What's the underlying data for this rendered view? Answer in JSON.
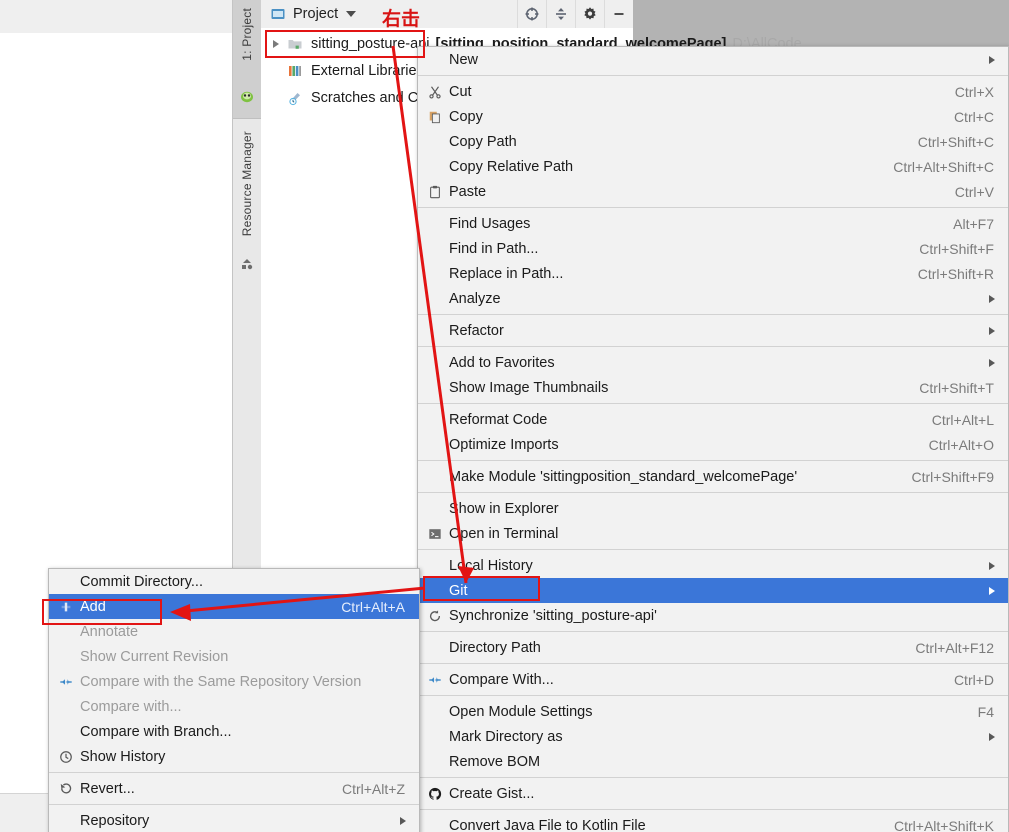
{
  "ide": {
    "toolwindow_tabs": [
      {
        "label": "1: Project",
        "icon": "project-icon",
        "active": true
      },
      {
        "label": "Resource Manager",
        "icon": "resource-manager-icon",
        "active": false
      }
    ],
    "tree_header": {
      "title": "Project",
      "icon": "project-folder-icon",
      "caret": "chevron-down-icon"
    },
    "tree_toolbar": [
      {
        "icon": "locate-icon"
      },
      {
        "icon": "collapse-all-icon"
      },
      {
        "icon": "gear-icon"
      },
      {
        "icon": "minimize-icon"
      }
    ],
    "tree_rows": [
      {
        "label": "sitting_posture-api",
        "detail": "[sitting_position_standard_welcomePage]",
        "path": "D:\\AllCode",
        "icon": "module-folder-icon",
        "expandable": true
      },
      {
        "label": "External Libraries",
        "icon": "external-libraries-icon",
        "expandable": false
      },
      {
        "label": "Scratches and Consoles",
        "icon": "scratches-icon",
        "expandable": false
      }
    ]
  },
  "annotations": {
    "right_click_label": "右击"
  },
  "context_menu": {
    "items": [
      {
        "label": "New",
        "icon": "",
        "accel": "",
        "submenu": true
      },
      {
        "sep": true
      },
      {
        "label": "Cut",
        "icon": "cut-icon",
        "accel": "Ctrl+X",
        "submenu": false
      },
      {
        "label": "Copy",
        "icon": "copy-icon",
        "accel": "Ctrl+C",
        "submenu": false
      },
      {
        "label": "Copy Path",
        "icon": "",
        "accel": "Ctrl+Shift+C",
        "submenu": false
      },
      {
        "label": "Copy Relative Path",
        "icon": "",
        "accel": "Ctrl+Alt+Shift+C",
        "submenu": false
      },
      {
        "label": "Paste",
        "icon": "paste-icon",
        "accel": "Ctrl+V",
        "submenu": false
      },
      {
        "sep": true
      },
      {
        "label": "Find Usages",
        "icon": "",
        "accel": "Alt+F7",
        "submenu": false
      },
      {
        "label": "Find in Path...",
        "icon": "",
        "accel": "Ctrl+Shift+F",
        "submenu": false
      },
      {
        "label": "Replace in Path...",
        "icon": "",
        "accel": "Ctrl+Shift+R",
        "submenu": false
      },
      {
        "label": "Analyze",
        "icon": "",
        "accel": "",
        "submenu": true
      },
      {
        "sep": true
      },
      {
        "label": "Refactor",
        "icon": "",
        "accel": "",
        "submenu": true
      },
      {
        "sep": true
      },
      {
        "label": "Add to Favorites",
        "icon": "",
        "accel": "",
        "submenu": true
      },
      {
        "label": "Show Image Thumbnails",
        "icon": "",
        "accel": "Ctrl+Shift+T",
        "submenu": false
      },
      {
        "sep": true
      },
      {
        "label": "Reformat Code",
        "icon": "",
        "accel": "Ctrl+Alt+L",
        "submenu": false
      },
      {
        "label": "Optimize Imports",
        "icon": "",
        "accel": "Ctrl+Alt+O",
        "submenu": false
      },
      {
        "sep": true
      },
      {
        "label": "Make Module 'sittingposition_standard_welcomePage'",
        "icon": "",
        "accel": "Ctrl+Shift+F9",
        "submenu": false
      },
      {
        "sep": true
      },
      {
        "label": "Show in Explorer",
        "icon": "",
        "accel": "",
        "submenu": false
      },
      {
        "label": "Open in Terminal",
        "icon": "terminal-icon",
        "accel": "",
        "submenu": false
      },
      {
        "sep": true
      },
      {
        "label": "Local History",
        "icon": "",
        "accel": "",
        "submenu": true
      },
      {
        "label": "Git",
        "icon": "",
        "accel": "",
        "submenu": true,
        "selected": true
      },
      {
        "label": "Synchronize 'sitting_posture-api'",
        "icon": "sync-icon",
        "accel": "",
        "submenu": false
      },
      {
        "sep": true
      },
      {
        "label": "Directory Path",
        "icon": "",
        "accel": "Ctrl+Alt+F12",
        "submenu": false
      },
      {
        "sep": true
      },
      {
        "label": "Compare With...",
        "icon": "compare-icon",
        "accel": "Ctrl+D",
        "submenu": false
      },
      {
        "sep": true
      },
      {
        "label": "Open Module Settings",
        "icon": "",
        "accel": "F4",
        "submenu": false
      },
      {
        "label": "Mark Directory as",
        "icon": "",
        "accel": "",
        "submenu": true
      },
      {
        "label": "Remove BOM",
        "icon": "",
        "accel": "",
        "submenu": false
      },
      {
        "sep": true
      },
      {
        "label": "Create Gist...",
        "icon": "github-icon",
        "accel": "",
        "submenu": false
      },
      {
        "sep": true
      },
      {
        "label": "Convert Java File to Kotlin File",
        "icon": "",
        "accel": "Ctrl+Alt+Shift+K",
        "submenu": false
      }
    ]
  },
  "git_submenu": {
    "items": [
      {
        "label": "Commit Directory...",
        "icon": "",
        "accel": "",
        "submenu": false,
        "disabled": false
      },
      {
        "label": "Add",
        "icon": "add-vcs-icon",
        "accel": "Ctrl+Alt+A",
        "submenu": false,
        "selected": true
      },
      {
        "label": "Annotate",
        "icon": "",
        "accel": "",
        "submenu": false,
        "disabled": true
      },
      {
        "label": "Show Current Revision",
        "icon": "",
        "accel": "",
        "submenu": false,
        "disabled": true
      },
      {
        "label": "Compare with the Same Repository Version",
        "icon": "compare-icon",
        "accel": "",
        "submenu": false,
        "disabled": true
      },
      {
        "label": "Compare with...",
        "icon": "",
        "accel": "",
        "submenu": false,
        "disabled": true
      },
      {
        "label": "Compare with Branch...",
        "icon": "",
        "accel": "",
        "submenu": false,
        "disabled": false
      },
      {
        "label": "Show History",
        "icon": "history-icon",
        "accel": "",
        "submenu": false,
        "disabled": false
      },
      {
        "sep": true
      },
      {
        "label": "Revert...",
        "icon": "revert-icon",
        "accel": "Ctrl+Alt+Z",
        "submenu": false,
        "disabled": false
      },
      {
        "sep": true
      },
      {
        "label": "Repository",
        "icon": "",
        "accel": "",
        "submenu": true,
        "disabled": false
      }
    ]
  },
  "colors": {
    "selection": "#3b76d8",
    "annotation_red": "#e21414",
    "menu_bg": "#f2f2f2",
    "accel_text": "#7b7b7b"
  }
}
